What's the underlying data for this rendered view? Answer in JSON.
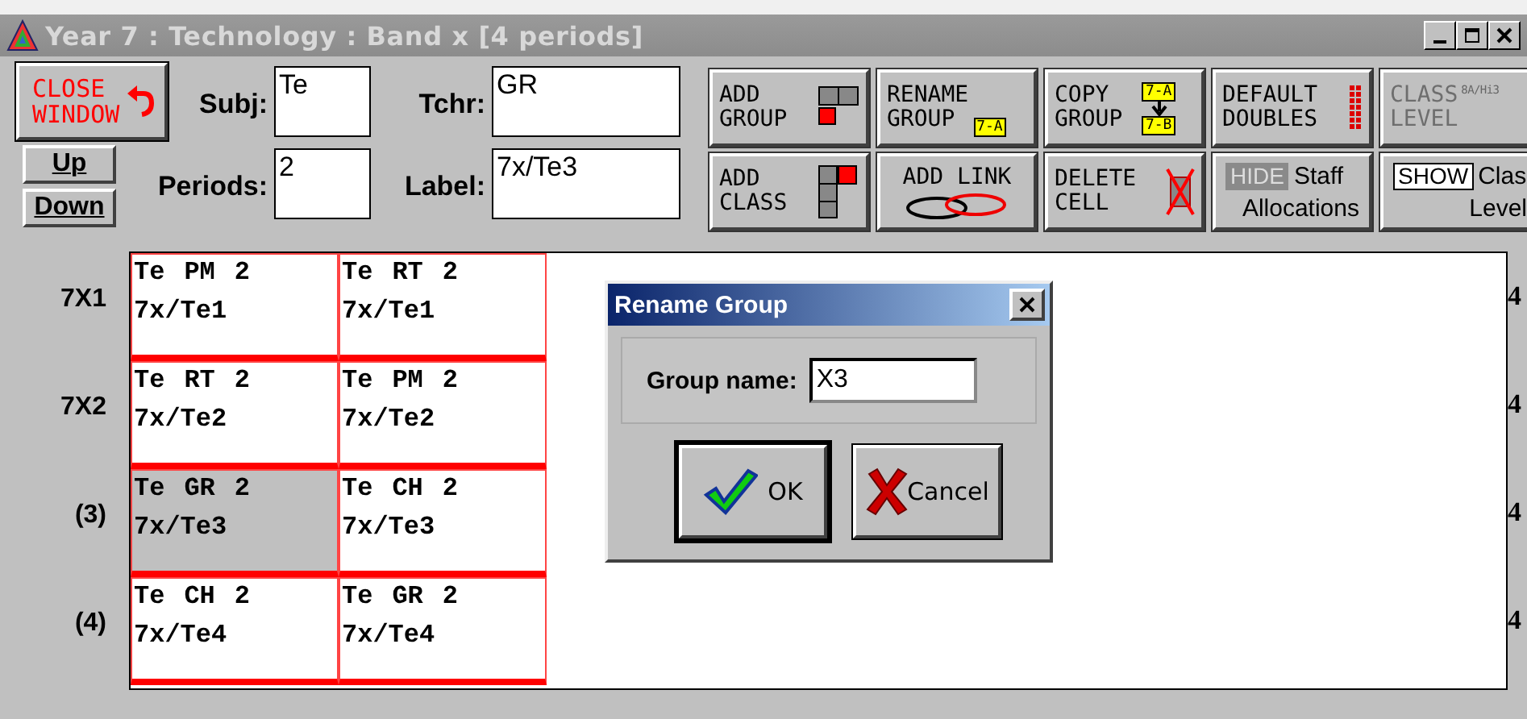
{
  "window": {
    "title": "Year 7 : Technology : Band x [4 periods]"
  },
  "close_button": {
    "lines": [
      "CLOSE",
      "WINDOW"
    ]
  },
  "nav_buttons": [
    "Up",
    "Down"
  ],
  "fields": [
    {
      "label": "Subj:",
      "value": "Te"
    },
    {
      "label": "Tchr:",
      "value": "GR"
    },
    {
      "label": "Periods:",
      "value": "2"
    },
    {
      "label": "Label:",
      "value": "7x/Te3"
    }
  ],
  "toolbar": [
    {
      "kind": "add-group",
      "lines": [
        "ADD",
        "GROUP"
      ],
      "disabled": false
    },
    {
      "kind": "rename-group",
      "lines": [
        "RENAME",
        "GROUP"
      ],
      "tags": [
        "7-A"
      ],
      "disabled": false
    },
    {
      "kind": "copy-group",
      "lines": [
        "COPY",
        "GROUP"
      ],
      "tags": [
        "7-A",
        "7-B"
      ],
      "disabled": false
    },
    {
      "kind": "default-doubles",
      "lines": [
        "DEFAULT",
        "DOUBLES"
      ],
      "disabled": false
    },
    {
      "kind": "class-level",
      "lines": [
        "CLASS",
        "LEVEL"
      ],
      "tags": [
        "8A/Hi3"
      ],
      "disabled": true
    },
    {
      "kind": "add-class",
      "lines": [
        "ADD",
        "CLASS"
      ],
      "disabled": false
    },
    {
      "kind": "add-link",
      "lines": [
        "ADD LINK"
      ],
      "disabled": false
    },
    {
      "kind": "delete-cell",
      "lines": [
        "DELETE",
        "CELL"
      ],
      "disabled": false
    },
    {
      "kind": "toggle",
      "tag": "HIDE",
      "toggle_on": true,
      "lines": [
        "Staff",
        "Allocations"
      ],
      "disabled": false
    },
    {
      "kind": "toggle",
      "tag": "SHOW",
      "toggle_on": false,
      "lines": [
        "Clas",
        "Level"
      ],
      "disabled": false
    }
  ],
  "grid": {
    "rows": [
      {
        "label": "7X1",
        "total": "4",
        "cells": [
          {
            "subject": "Te",
            "teacher": "PM",
            "periods": "2",
            "label": "7x/Te1",
            "selected": false
          },
          {
            "subject": "Te",
            "teacher": "RT",
            "periods": "2",
            "label": "7x/Te1",
            "selected": false
          }
        ]
      },
      {
        "label": "7X2",
        "total": "4",
        "cells": [
          {
            "subject": "Te",
            "teacher": "RT",
            "periods": "2",
            "label": "7x/Te2",
            "selected": false
          },
          {
            "subject": "Te",
            "teacher": "PM",
            "periods": "2",
            "label": "7x/Te2",
            "selected": false
          }
        ]
      },
      {
        "label": "(3)",
        "total": "4",
        "cells": [
          {
            "subject": "Te",
            "teacher": "GR",
            "periods": "2",
            "label": "7x/Te3",
            "selected": true
          },
          {
            "subject": "Te",
            "teacher": "CH",
            "periods": "2",
            "label": "7x/Te3",
            "selected": false
          }
        ]
      },
      {
        "label": "(4)",
        "total": "4",
        "cells": [
          {
            "subject": "Te",
            "teacher": "CH",
            "periods": "2",
            "label": "7x/Te4",
            "selected": false
          },
          {
            "subject": "Te",
            "teacher": "GR",
            "periods": "2",
            "label": "7x/Te4",
            "selected": false
          }
        ]
      }
    ]
  },
  "dialog": {
    "title": "Rename Group",
    "field_label": "Group name:",
    "value": "X3",
    "buttons": [
      {
        "kind": "ok",
        "label": "OK"
      },
      {
        "kind": "cancel",
        "label": "Cancel"
      }
    ]
  }
}
